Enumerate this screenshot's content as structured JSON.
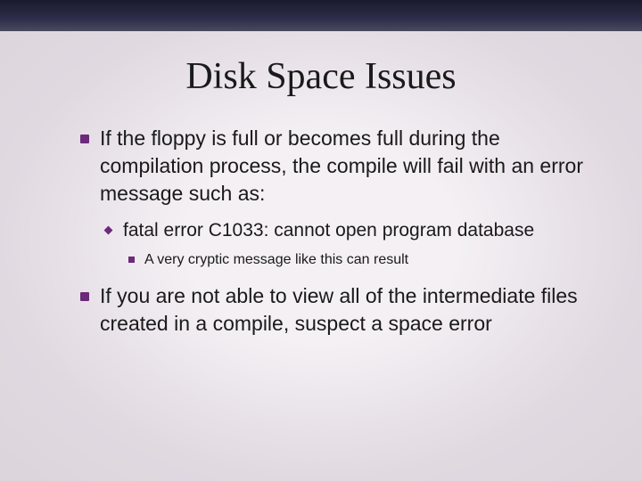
{
  "title": "Disk Space Issues",
  "bullets": [
    {
      "text": "If the floppy is full or becomes full during the compilation process, the compile will fail with an error message such as:",
      "children": [
        {
          "text": "fatal error C1033: cannot open program database",
          "children": [
            {
              "text": "A very cryptic message like this can result"
            }
          ]
        }
      ]
    },
    {
      "text": "If you are not able to view all of the intermediate files created in a compile, suspect a space error"
    }
  ]
}
